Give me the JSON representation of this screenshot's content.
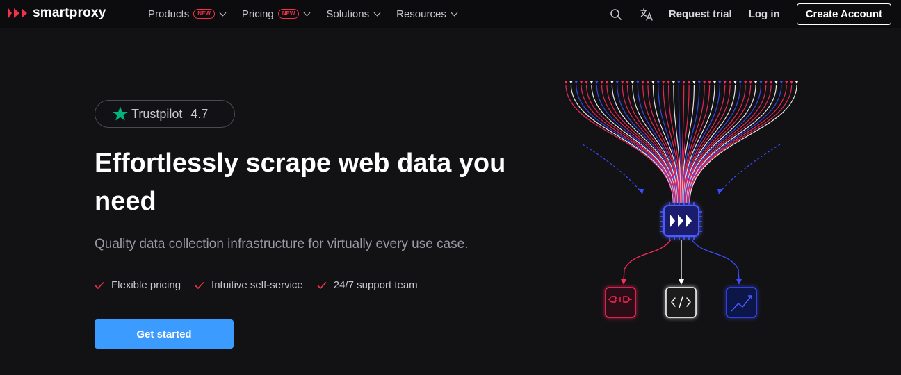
{
  "brand": {
    "name": "smartproxy",
    "accent": "#f0324b"
  },
  "nav": {
    "menu": [
      {
        "label": "Products",
        "badge": "NEW"
      },
      {
        "label": "Pricing",
        "badge": "NEW"
      },
      {
        "label": "Solutions",
        "badge": ""
      },
      {
        "label": "Resources",
        "badge": ""
      }
    ],
    "icons": [
      "search-icon",
      "translate-icon"
    ],
    "request_trial": "Request trial",
    "log_in": "Log in",
    "create_account": "Create Account"
  },
  "hero": {
    "rating": {
      "provider": "Trustpilot",
      "score": "4.7",
      "star_color": "#00b67a"
    },
    "headline": "Effortlessly scrape web data you need",
    "subheadline": "Quality data collection infrastructure for virtually every use case.",
    "features": [
      "Flexible pricing",
      "Intuitive self-service",
      "24/7 support team"
    ],
    "cta": "Get started",
    "cta_color": "#3b9bff"
  },
  "illustration": {
    "outputs": [
      "plug-icon",
      "code-icon",
      "chart-icon"
    ],
    "colors": {
      "red": "#ff2a5c",
      "white": "#ffffff",
      "blue": "#3a4cff"
    }
  }
}
